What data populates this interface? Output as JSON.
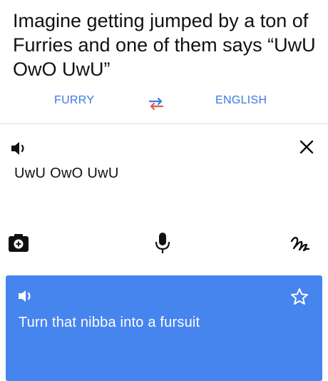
{
  "caption": "Imagine getting jumped by a ton of Furries and one of them says “UwU OwO UwU”",
  "languages": {
    "source": "FURRY",
    "target": "ENGLISH"
  },
  "input": {
    "text": "UwU OwO UwU"
  },
  "output": {
    "text": "Turn that nibba into a fursuit"
  },
  "colors": {
    "accent": "#3b78e7",
    "output_card": "#4685ee"
  },
  "icons": {
    "swap": "swap-arrows-icon",
    "speaker": "speaker-icon",
    "close": "close-icon",
    "camera": "camera-icon",
    "mic": "microphone-icon",
    "handwriting": "handwriting-icon",
    "star": "star-icon"
  }
}
